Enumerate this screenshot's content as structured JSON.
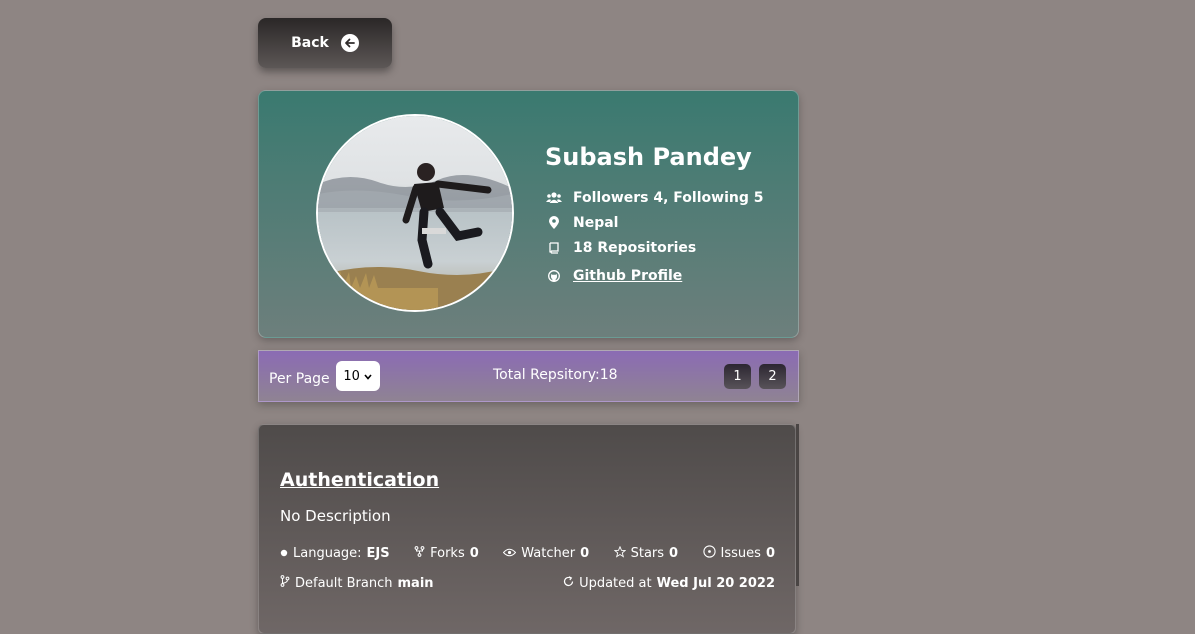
{
  "back_button": {
    "label": "Back",
    "icon": "arrow-left-circle-icon"
  },
  "profile": {
    "name": "Subash Pandey",
    "followers_text": "Followers 4, Following 5",
    "location": "Nepal",
    "repos_text": "18 Repositories",
    "github_link": "Github Profile",
    "icons": [
      "users-icon",
      "map-pin-icon",
      "book-icon",
      "github-icon"
    ]
  },
  "toolbar": {
    "per_page_label": "Per Page",
    "per_page_value": "10",
    "total_text": "Total Repsitory:18",
    "pages": [
      "1",
      "2"
    ]
  },
  "repo": {
    "title": "Authentication",
    "description": "No Description",
    "language_label": "Language:",
    "language_value": "EJS",
    "forks_label": "Forks",
    "forks_value": "0",
    "watcher_label": "Watcher",
    "watcher_value": "0",
    "stars_label": "Stars",
    "stars_value": "0",
    "issues_label": "Issues",
    "issues_value": "0",
    "branch_label": "Default Branch",
    "branch_value": "main",
    "updated_label": "Updated at",
    "updated_value": "Wed Jul 20 2022"
  }
}
